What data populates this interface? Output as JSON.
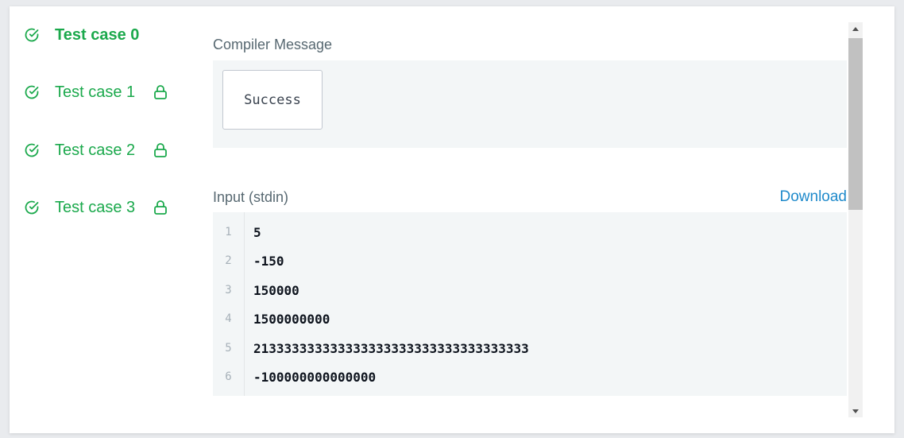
{
  "test_cases": [
    {
      "label": "Test case 0",
      "active": true,
      "locked": false
    },
    {
      "label": "Test case 1",
      "active": false,
      "locked": true
    },
    {
      "label": "Test case 2",
      "active": false,
      "locked": true
    },
    {
      "label": "Test case 3",
      "active": false,
      "locked": true
    }
  ],
  "compiler": {
    "title": "Compiler Message",
    "message": "Success"
  },
  "input": {
    "title": "Input (stdin)",
    "download_label": "Download",
    "lines": [
      {
        "num": "1",
        "text": "5"
      },
      {
        "num": "2",
        "text": "-150"
      },
      {
        "num": "3",
        "text": "150000"
      },
      {
        "num": "4",
        "text": "1500000000"
      },
      {
        "num": "5",
        "text": "213333333333333333333333333333333333"
      },
      {
        "num": "6",
        "text": "-100000000000000"
      }
    ]
  },
  "colors": {
    "success_green": "#1ba94c",
    "link_blue": "#1f8acb",
    "code_bg": "#f3f6f7"
  },
  "icons": {
    "check": "check-circle-icon",
    "lock": "lock-icon",
    "scroll_up": "triangle-up-icon",
    "scroll_down": "triangle-down-icon"
  }
}
